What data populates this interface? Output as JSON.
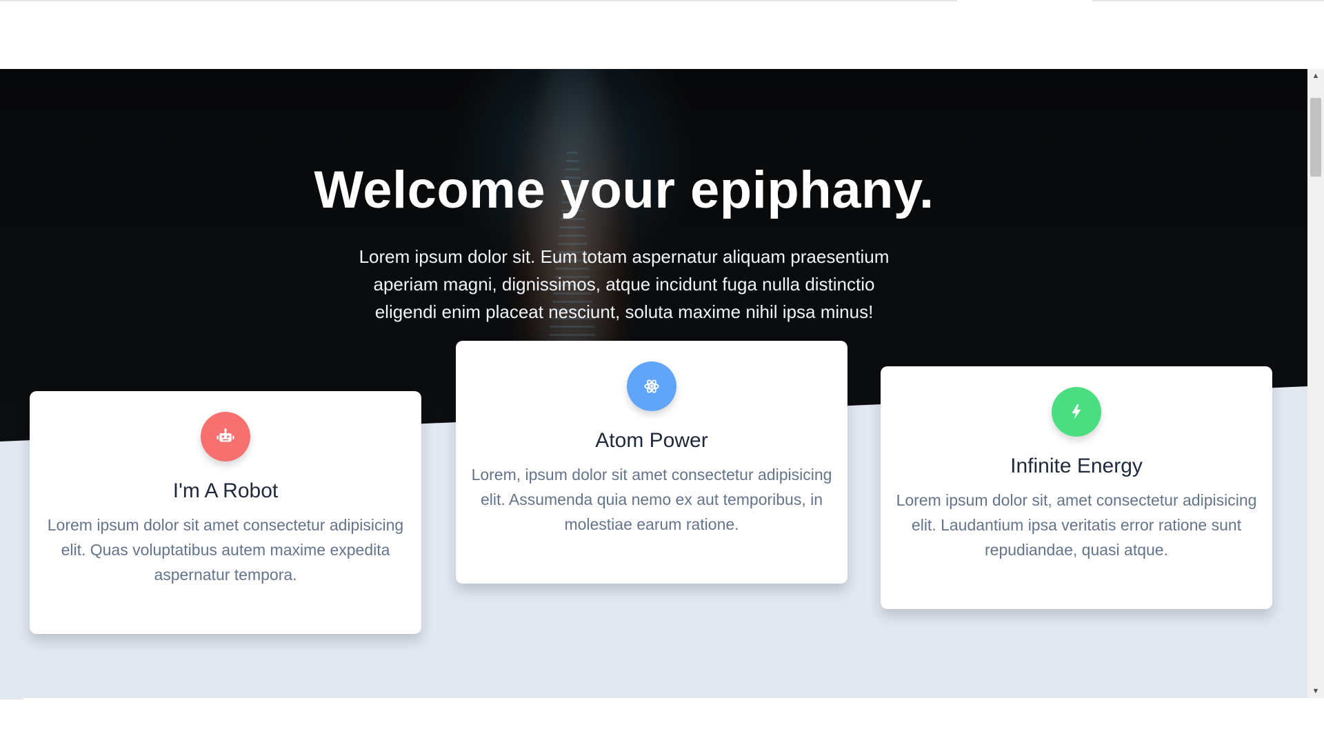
{
  "hero": {
    "title": "Welcome your epiphany.",
    "text": "Lorem ipsum dolor sit. Eum totam aspernatur aliquam praesentium aperiam magni, dignissimos, atque incidunt fuga nulla distinctio eligendi enim placeat nesciunt, soluta maxime nihil ipsa minus!"
  },
  "cards": [
    {
      "icon": "robot-icon",
      "color": "#f87171",
      "title": "I'm A Robot",
      "text": "Lorem ipsum dolor sit amet consectetur adipisicing elit. Quas voluptatibus autem maxime expedita aspernatur tempora."
    },
    {
      "icon": "atom-icon",
      "color": "#60a5fa",
      "title": "Atom Power",
      "text": "Lorem, ipsum dolor sit amet consectetur adipisicing elit. Assumenda quia nemo ex aut temporibus, in molestiae earum ratione."
    },
    {
      "icon": "bolt-icon",
      "color": "#4ade80",
      "title": "Infinite Energy",
      "text": "Lorem ipsum dolor sit, amet consectetur adipisicing elit. Laudantium ipsa veritatis error ratione sunt repudiandae, quasi atque."
    }
  ],
  "colors": {
    "section_background": "#e2e8f0",
    "card_title": "#1e293b",
    "card_text": "#64748b"
  }
}
